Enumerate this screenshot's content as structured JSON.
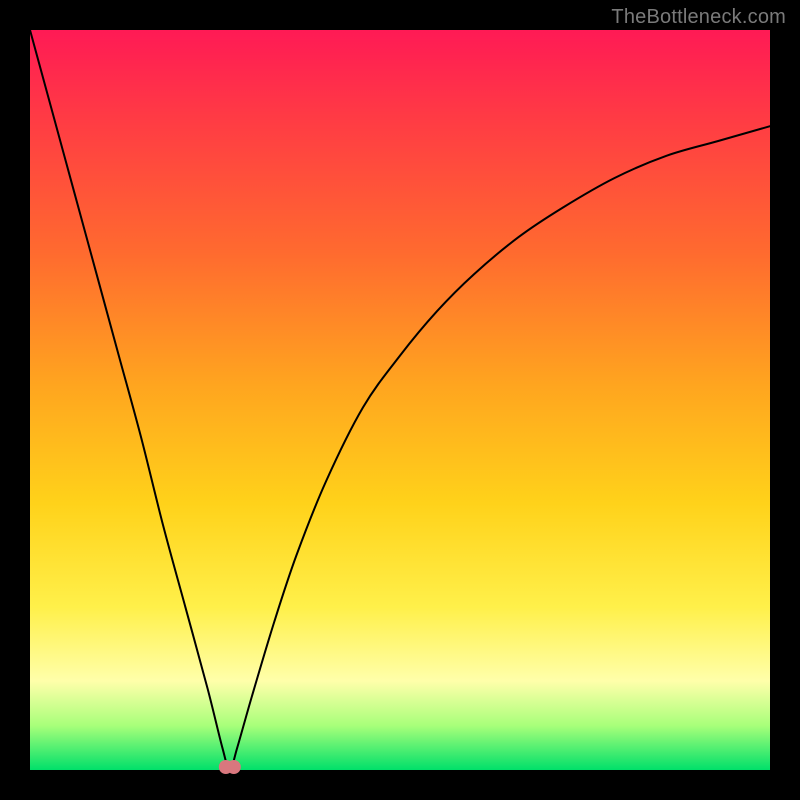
{
  "watermark": "TheBottleneck.com",
  "chart_data": {
    "type": "line",
    "title": "",
    "xlabel": "",
    "ylabel": "",
    "xlim": [
      0,
      100
    ],
    "ylim": [
      0,
      100
    ],
    "grid": false,
    "legend": false,
    "background_gradient": {
      "direction": "vertical",
      "stops": [
        {
          "pos": 0.0,
          "color": "#ff1a55"
        },
        {
          "pos": 0.12,
          "color": "#ff3b44"
        },
        {
          "pos": 0.3,
          "color": "#ff6a2f"
        },
        {
          "pos": 0.48,
          "color": "#ffa51f"
        },
        {
          "pos": 0.64,
          "color": "#ffd21a"
        },
        {
          "pos": 0.78,
          "color": "#fff04a"
        },
        {
          "pos": 0.88,
          "color": "#ffffaa"
        },
        {
          "pos": 0.94,
          "color": "#a8ff7a"
        },
        {
          "pos": 1.0,
          "color": "#00e06a"
        }
      ]
    },
    "series": [
      {
        "name": "bottleneck-curve",
        "color": "#000000",
        "stroke_width": 2,
        "note": "V-shaped curve; minimum (y≈0) near x≈27; left arm nearly linear to top-left corner; right arm rises with diminishing slope toward top-right.",
        "x": [
          0,
          3,
          6,
          9,
          12,
          15,
          18,
          21,
          24,
          26,
          27,
          28,
          30,
          33,
          36,
          40,
          45,
          50,
          55,
          60,
          66,
          72,
          79,
          86,
          93,
          100
        ],
        "y": [
          100,
          89,
          78,
          67,
          56,
          45,
          33,
          22,
          11,
          3,
          0,
          3,
          10,
          20,
          29,
          39,
          49,
          56,
          62,
          67,
          72,
          76,
          80,
          83,
          85,
          87
        ]
      }
    ],
    "trough_marker": {
      "x": 27,
      "y": 0,
      "color": "#d9777e",
      "radius_px": 7
    }
  }
}
